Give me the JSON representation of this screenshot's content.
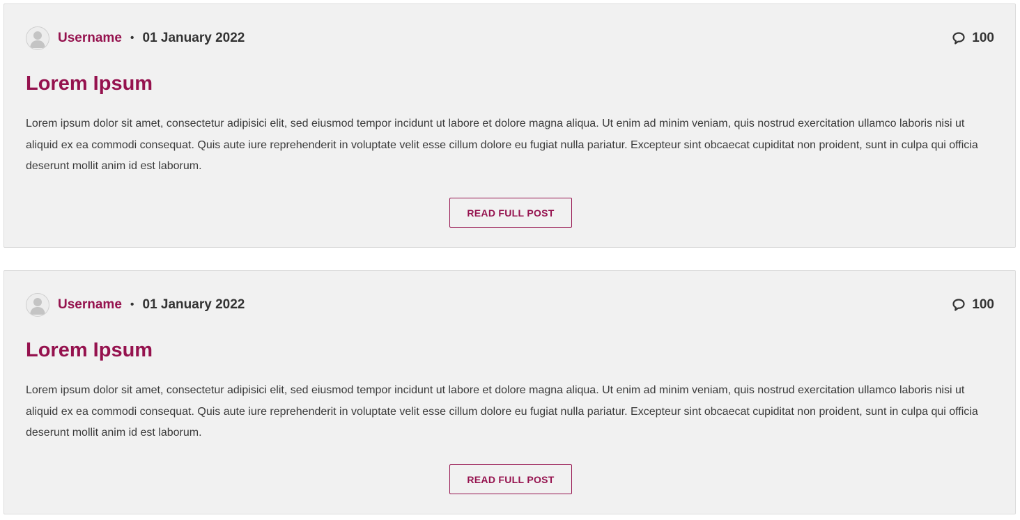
{
  "accent_color": "#95124e",
  "posts": [
    {
      "username": "Username",
      "separator": "•",
      "date": "01 January 2022",
      "comment_icon": "comment-bubble-icon",
      "comment_count": "100",
      "title": "Lorem Ipsum",
      "excerpt": "Lorem ipsum dolor sit amet, consectetur adipisici elit, sed eiusmod tempor incidunt ut labore et dolore magna aliqua. Ut enim ad minim veniam, quis nostrud exercitation ullamco laboris nisi ut aliquid ex ea commodi consequat. Quis aute iure reprehenderit in voluptate velit esse cillum dolore eu fugiat nulla pariatur. Excepteur sint obcaecat cupiditat non proident, sunt in culpa qui officia deserunt mollit anim id est laborum.",
      "button_label": "READ FULL POST"
    },
    {
      "username": "Username",
      "separator": "•",
      "date": "01 January 2022",
      "comment_icon": "comment-bubble-icon",
      "comment_count": "100",
      "title": "Lorem Ipsum",
      "excerpt": "Lorem ipsum dolor sit amet, consectetur adipisici elit, sed eiusmod tempor incidunt ut labore et dolore magna aliqua. Ut enim ad minim veniam, quis nostrud exercitation ullamco laboris nisi ut aliquid ex ea commodi consequat. Quis aute iure reprehenderit in voluptate velit esse cillum dolore eu fugiat nulla pariatur. Excepteur sint obcaecat cupiditat non proident, sunt in culpa qui officia deserunt mollit anim id est laborum.",
      "button_label": "READ FULL POST"
    }
  ]
}
